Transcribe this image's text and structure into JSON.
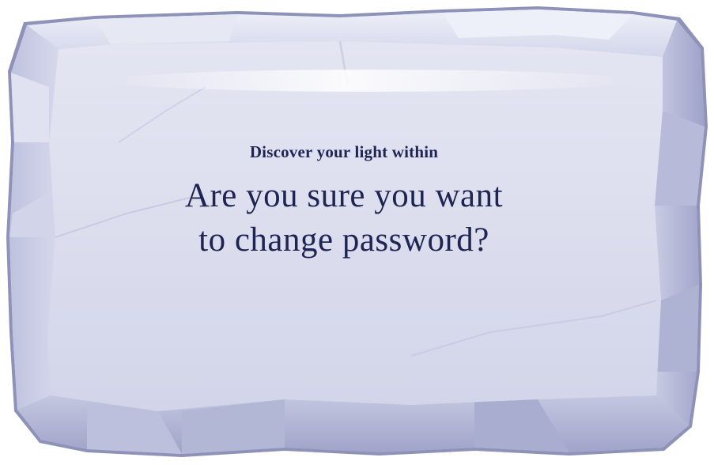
{
  "dialog": {
    "subtitle": "Discover your light within",
    "question_line1": "Are you sure you want",
    "question_line2": "to change password?"
  },
  "colors": {
    "text": "#1f2552",
    "stone_face": "#dadcec",
    "stone_edge": "#b4b8d6",
    "stone_shadow": "#9094bd"
  }
}
